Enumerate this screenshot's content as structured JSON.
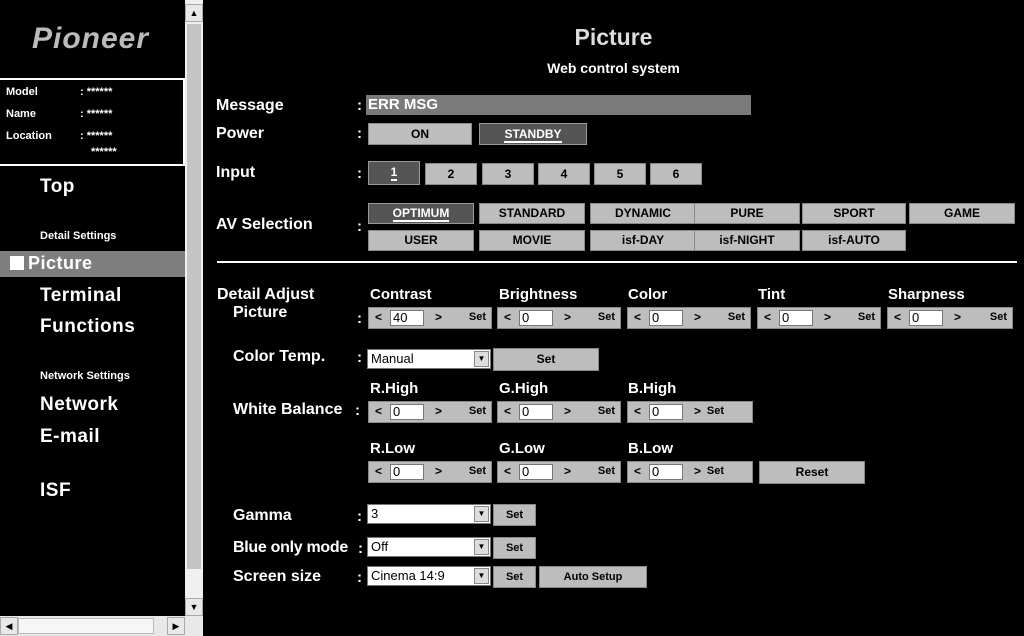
{
  "sidebar": {
    "logo": "Pioneer",
    "info": {
      "model_label": "Model",
      "model_value": ": ******",
      "name_label": "Name",
      "name_value": ": ******",
      "location_label": "Location",
      "location_value": ": ******",
      "location_value2": "******"
    },
    "nav": {
      "top": "Top",
      "detail_settings": "Detail Settings",
      "picture": "Picture",
      "terminal": "Terminal",
      "functions": "Functions",
      "network_settings": "Network Settings",
      "network": "Network",
      "email": "E-mail",
      "isf": "ISF"
    }
  },
  "header": {
    "title": "Picture",
    "subtitle": "Web control system"
  },
  "labels": {
    "colon": ":",
    "message": "Message",
    "power": "Power",
    "input": "Input",
    "av_selection": "AV Selection",
    "detail_adjust": "Detail Adjust",
    "picture": "Picture",
    "color_temp": "Color Temp.",
    "white_balance": "White Balance",
    "gamma": "Gamma",
    "blue_only": "Blue only mode",
    "screen_size": "Screen size"
  },
  "message": {
    "value": "ERR MSG"
  },
  "power": {
    "on": "ON",
    "standby": "STANDBY",
    "selected": "STANDBY"
  },
  "input": {
    "items": [
      "1",
      "2",
      "3",
      "4",
      "5",
      "6"
    ],
    "selected": "1"
  },
  "av_selection": {
    "row1": [
      "OPTIMUM",
      "STANDARD",
      "DYNAMIC",
      "PURE",
      "SPORT",
      "GAME"
    ],
    "row2": [
      "USER",
      "MOVIE",
      "isf-DAY",
      "isf-NIGHT",
      "isf-AUTO"
    ],
    "selected": "OPTIMUM"
  },
  "picture_adjust": {
    "contrast": {
      "label": "Contrast",
      "value": "40"
    },
    "brightness": {
      "label": "Brightness",
      "value": "0"
    },
    "color": {
      "label": "Color",
      "value": "0"
    },
    "tint": {
      "label": "Tint",
      "value": "0"
    },
    "sharpness": {
      "label": "Sharpness",
      "value": "0"
    }
  },
  "controls": {
    "dec": "<",
    "inc": ">",
    "set": "Set",
    "reset": "Reset",
    "auto_setup": "Auto Setup"
  },
  "color_temp": {
    "value": "Manual"
  },
  "white_balance": {
    "r_high": {
      "label": "R.High",
      "value": "0"
    },
    "g_high": {
      "label": "G.High",
      "value": "0"
    },
    "b_high": {
      "label": "B.High",
      "value": "0"
    },
    "r_low": {
      "label": "R.Low",
      "value": "0"
    },
    "g_low": {
      "label": "G.Low",
      "value": "0"
    },
    "b_low": {
      "label": "B.Low",
      "value": "0"
    }
  },
  "gamma": {
    "value": "3"
  },
  "blue_only": {
    "value": "Off"
  },
  "screen_size": {
    "value": "Cinema 14:9"
  },
  "colors": {
    "background": "#000000",
    "button": "#bdbdbd",
    "selected_button": "#555555",
    "message_bar": "#7a7a7a"
  },
  "icons": {
    "up": "scroll-up-icon",
    "down": "scroll-down-icon",
    "left": "scroll-left-icon",
    "right": "scroll-right-icon",
    "dropdown": "chevron-down-icon"
  }
}
